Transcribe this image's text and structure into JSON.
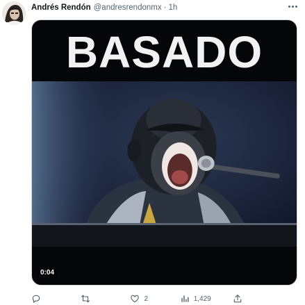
{
  "tweet": {
    "author_name": "Andrés Rendón",
    "handle": "@andresrendonmx",
    "separator": "·",
    "time": "1h"
  },
  "media": {
    "banner_text": "BASADO",
    "duration": "0:04"
  },
  "actions": {
    "reply_count": "",
    "retweet_count": "",
    "like_count": "2",
    "views_count": "1,429",
    "share_count": ""
  },
  "icons": {
    "avatar": "avatar",
    "more": "more-icon",
    "reply": "reply-icon",
    "retweet": "retweet-icon",
    "like": "heart-icon",
    "views": "views-icon",
    "share": "share-icon"
  },
  "colors": {
    "secondary_text": "#536471",
    "media_background": "#050608"
  }
}
